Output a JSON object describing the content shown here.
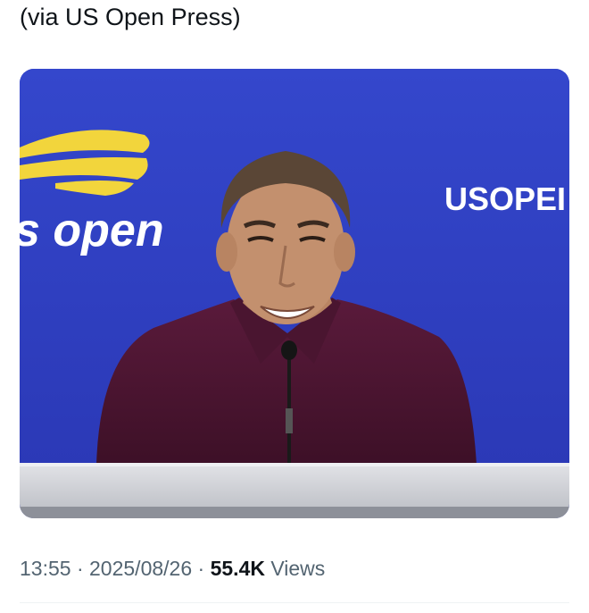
{
  "post": {
    "caption": "(via US Open Press)",
    "time": "13:55",
    "separator": "·",
    "date": "2025/08/26",
    "view_count": "55.4K",
    "views_label": "Views"
  },
  "media": {
    "backdrop_text_left": "s open",
    "backdrop_text_right": "USOPEI"
  },
  "colors": {
    "backdrop_blue": "#2f3fc4",
    "logo_yellow": "#f2d53c",
    "shirt": "#4a1530",
    "desk": "#d6d7dc"
  }
}
